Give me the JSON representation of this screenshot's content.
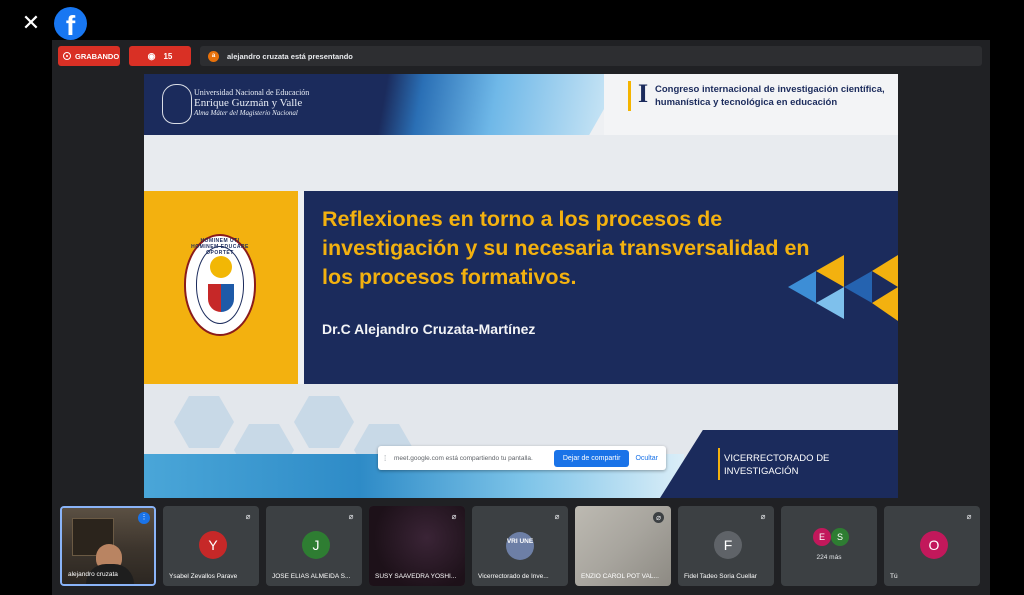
{
  "app": {
    "close_icon_glyph": "✕",
    "facebook_logo_glyph": "f"
  },
  "meet": {
    "recording_label": "GRABANDO",
    "viewers_count": "15",
    "presenter_initial": "a",
    "presenter_status": "alejandro cruzata está presentando"
  },
  "slide": {
    "university_line1": "Universidad Nacional de Educación",
    "university_line2": "Enrique Guzmán y Valle",
    "university_line3": "Alma Máter del Magisterio Nacional",
    "congress_numeral": "I",
    "congress_title": "Congreso internacional de investigación científica, humanística y tecnológica en educación",
    "seal_text": "HOMINEM UTI HOMINEM EDUCARE OPORTET",
    "title": "Reflexiones en torno a los procesos de investigación y su necesaria transversalidad en los procesos formativos.",
    "author": "Dr.C Alejandro Cruzata-Martínez",
    "vice_rectorate": "VICERRECTORADO DE INVESTIGACIÓN"
  },
  "share_bar": {
    "handle_glyph": "⁞",
    "message": "meet.google.com está compartiendo tu pantalla.",
    "stop_label": "Dejar de compartir",
    "hide_label": "Ocultar"
  },
  "participants": [
    {
      "name": "alejandro cruzata",
      "type": "camera"
    },
    {
      "name": "Ysabel Zevallos Parave",
      "initial": "Y",
      "color": "#c62828"
    },
    {
      "name": "JOSE ELIAS ALMEIDA S...",
      "initial": "J",
      "color": "#2e7d32"
    },
    {
      "name": "SUSY SAAVEDRA YOSHI...",
      "type": "dark"
    },
    {
      "name": "Vicerrectorado de Inve...",
      "initial": "VRI UNE",
      "color": "#6d7fa6"
    },
    {
      "name": "ENZIO CAROL POT VAL...",
      "type": "blur"
    },
    {
      "name": "Fidel Tadeo Soria Cuellar",
      "initial": "F",
      "color": "#5f6368"
    },
    {
      "more": "224 más",
      "initials": [
        "E",
        "S"
      ],
      "colors": [
        "#c2185b",
        "#2e7d32"
      ]
    },
    {
      "name": "Tú",
      "initial": "O",
      "color": "#c2185b"
    }
  ],
  "icons": {
    "mute_glyph": "⌀",
    "options_glyph": "⋮"
  }
}
